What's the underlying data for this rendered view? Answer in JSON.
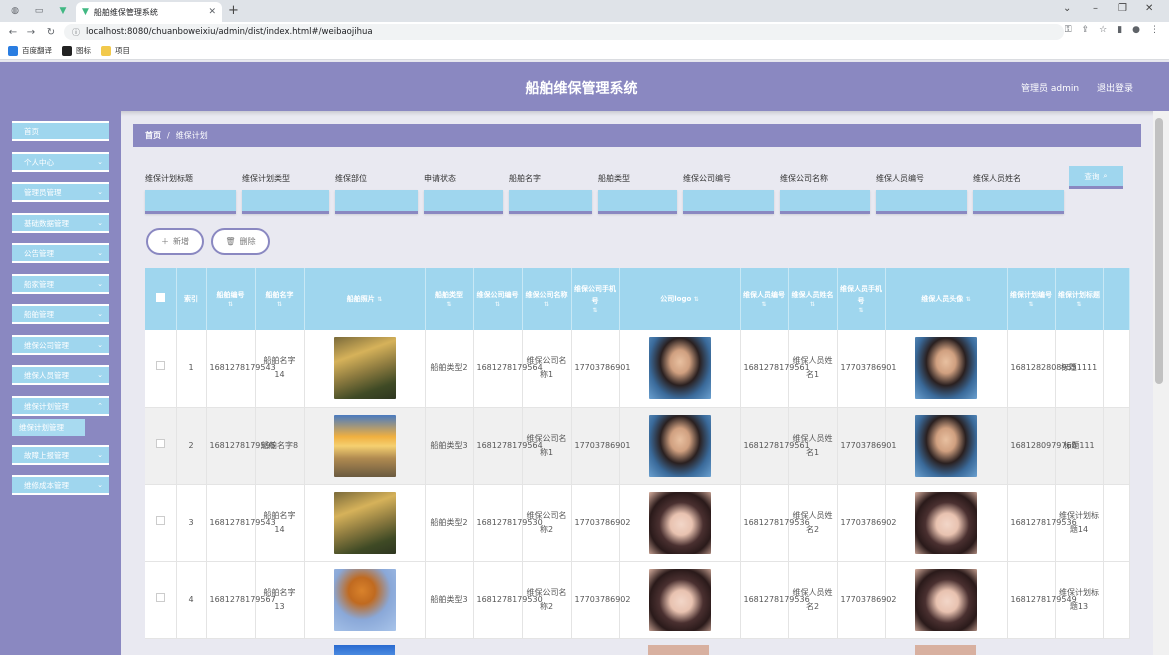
{
  "browser": {
    "tab_title": "船舶维保管理系统",
    "url": "localhost:8080/chuanboweixiu/admin/dist/index.html#/weibaojihua",
    "bookmarks": [
      "百度翻译",
      "图标",
      "项目"
    ]
  },
  "header": {
    "title": "船舶维保管理系统",
    "admin_label": "管理员 admin",
    "logout_label": "退出登录"
  },
  "sidebar": {
    "items": [
      {
        "label": "首页",
        "has_chevron": false
      },
      {
        "label": "个人中心",
        "has_chevron": true
      },
      {
        "label": "管理员管理",
        "has_chevron": true
      },
      {
        "label": "基础数据管理",
        "has_chevron": true
      },
      {
        "label": "公告管理",
        "has_chevron": true
      },
      {
        "label": "船家管理",
        "has_chevron": true
      },
      {
        "label": "船舶管理",
        "has_chevron": true
      },
      {
        "label": "维保公司管理",
        "has_chevron": true
      },
      {
        "label": "维保人员管理",
        "has_chevron": true
      },
      {
        "label": "维保计划管理",
        "has_chevron": true
      },
      {
        "label": "故障上报管理",
        "has_chevron": true
      },
      {
        "label": "维修成本管理",
        "has_chevron": true
      }
    ],
    "active_sub": "维保计划管理"
  },
  "breadcrumb": {
    "home": "首页",
    "separator": "/",
    "current": "维保计划"
  },
  "filters": {
    "labels": [
      "维保计划标题",
      "维保计划类型",
      "维保部位",
      "申请状态",
      "船舶名字",
      "船舶类型",
      "维保公司编号",
      "维保公司名称",
      "维保人员编号",
      "维保人员姓名"
    ],
    "query_label": "查询"
  },
  "actions": {
    "add_label": "新增",
    "delete_label": "删除"
  },
  "table": {
    "headers": [
      "索引",
      "船舶编号",
      "船舶名字",
      "船舶照片",
      "船舶类型",
      "维保公司编号",
      "维保公司名称",
      "维保公司手机号",
      "公司logo",
      "维保人员编号",
      "维保人员姓名",
      "维保人员手机号",
      "维保人员头像",
      "维保计划编号",
      "维保计划标题"
    ],
    "rows": [
      {
        "index": "1",
        "ship_no": "1681278179543",
        "ship_name": "船舶名字14",
        "ship_photo": "landscape1",
        "ship_type": "船舶类型2",
        "company_no": "1681278179564",
        "company_name": "维保公司名称1",
        "company_phone": "17703786901",
        "logo": "man",
        "staff_no": "1681278179561",
        "staff_name": "维保人员姓名1",
        "staff_phone": "17703786901",
        "avatar": "man",
        "plan_no": "1681282808955",
        "plan_title": "标题1111"
      },
      {
        "index": "2",
        "ship_no": "1681278179595",
        "ship_name": "船舶名字8",
        "ship_photo": "sunset",
        "ship_type": "船舶类型3",
        "company_no": "1681278179564",
        "company_name": "维保公司名称1",
        "company_phone": "17703786901",
        "logo": "man",
        "staff_no": "1681278179561",
        "staff_name": "维保人员姓名1",
        "staff_phone": "17703786901",
        "avatar": "man",
        "plan_no": "1681280979768",
        "plan_title": "标题111"
      },
      {
        "index": "3",
        "ship_no": "1681278179543",
        "ship_name": "船舶名字14",
        "ship_photo": "landscape1",
        "ship_type": "船舶类型2",
        "company_no": "1681278179530",
        "company_name": "维保公司名称2",
        "company_phone": "17703786902",
        "logo": "woman",
        "staff_no": "1681278179536",
        "staff_name": "维保人员姓名2",
        "staff_phone": "17703786902",
        "avatar": "woman",
        "plan_no": "1681278179536",
        "plan_title": "维保计划标题14"
      },
      {
        "index": "4",
        "ship_no": "1681278179567",
        "ship_name": "船舶名字13",
        "ship_photo": "tree",
        "ship_type": "船舶类型3",
        "company_no": "1681278179530",
        "company_name": "维保公司名称2",
        "company_phone": "17703786902",
        "logo": "woman",
        "staff_no": "1681278179536",
        "staff_name": "维保人员姓名2",
        "staff_phone": "17703786902",
        "avatar": "woman",
        "plan_no": "1681278179549",
        "plan_title": "维保计划标题13"
      }
    ]
  },
  "colors": {
    "header_bg": "#8a88c1",
    "menu_bg": "#9fd6ee",
    "table_header_bg": "#9fd6ee"
  }
}
